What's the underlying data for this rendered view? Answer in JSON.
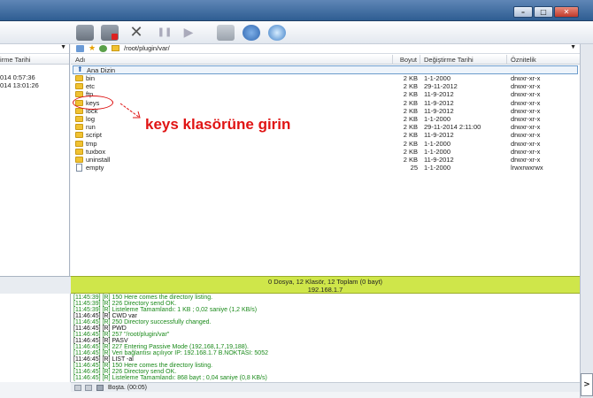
{
  "toolbar": {
    "icons": [
      "connect-icon",
      "disconnect-icon",
      "cancel-icon",
      "pause-icon",
      "play-icon",
      "queue-icon",
      "refresh-icon",
      "globe-icon"
    ],
    "path": "/root/plugin/var/"
  },
  "left_pane": {
    "header": "irme Tarihi",
    "dates": [
      "014 0:57:36",
      "014 13:01:26"
    ]
  },
  "file_list": {
    "columns": {
      "name": "Adı",
      "size": "Boyut",
      "date": "Değiştirme Tarihi",
      "perm": "Öznitelik"
    },
    "parent": "Ana Dizin",
    "rows": [
      {
        "name": "bin",
        "size": "2 KB",
        "date": "1-1-2000",
        "perm": "drwxr-xr-x",
        "type": "folder"
      },
      {
        "name": "etc",
        "size": "2 KB",
        "date": "29-11-2012",
        "perm": "drwxr-xr-x",
        "type": "folder"
      },
      {
        "name": "ftp",
        "size": "2 KB",
        "date": "11-9-2012",
        "perm": "drwxr-xr-x",
        "type": "folder"
      },
      {
        "name": "keys",
        "size": "2 KB",
        "date": "11-9-2012",
        "perm": "drwxr-xr-x",
        "type": "folder"
      },
      {
        "name": "lock",
        "size": "2 KB",
        "date": "11-9-2012",
        "perm": "drwxr-xr-x",
        "type": "folder"
      },
      {
        "name": "log",
        "size": "2 KB",
        "date": "1-1-2000",
        "perm": "drwxr-xr-x",
        "type": "folder"
      },
      {
        "name": "run",
        "size": "2 KB",
        "date": "29-11-2014 2:11:00",
        "perm": "drwxr-xr-x",
        "type": "folder"
      },
      {
        "name": "script",
        "size": "2 KB",
        "date": "11-9-2012",
        "perm": "drwxr-xr-x",
        "type": "folder"
      },
      {
        "name": "tmp",
        "size": "2 KB",
        "date": "1-1-2000",
        "perm": "drwxr-xr-x",
        "type": "folder"
      },
      {
        "name": "tuxbox",
        "size": "2 KB",
        "date": "1-1-2000",
        "perm": "drwxr-xr-x",
        "type": "folder"
      },
      {
        "name": "uninstall",
        "size": "2 KB",
        "date": "11-9-2012",
        "perm": "drwxr-xr-x",
        "type": "folder"
      },
      {
        "name": "empty",
        "size": "25",
        "date": "1-1-2000",
        "perm": "lrwxrwxrwx",
        "type": "file"
      }
    ]
  },
  "annotation": {
    "text": "keys klasörüne girin",
    "color": "#e01414"
  },
  "status": {
    "summary": "0 Dosya, 12 Klasör, 12 Toplam (0 bayt)",
    "host": "192.168.1.7"
  },
  "log": [
    {
      "text": "[11:45:39] [R] 150 Here comes the directory listing.",
      "color": "#1a8a1a"
    },
    {
      "text": "[11:45:39] [R] 226 Directory send OK.",
      "color": "#1a8a1a"
    },
    {
      "text": "[11:45:39] [R] Listeleme Tamamlandı: 1 KB ; 0,02 saniye (1,2 KB/s)",
      "color": "#1a8a1a"
    },
    {
      "text": "[11:46:45] [R] CWD var",
      "color": "#111111"
    },
    {
      "text": "[11:46:45] [R] 250 Directory successfully changed.",
      "color": "#1a8a1a"
    },
    {
      "text": "[11:46:45] [R] PWD",
      "color": "#111111"
    },
    {
      "text": "[11:46:45] [R] 257 \"/root/plugin/var\"",
      "color": "#1a8a1a"
    },
    {
      "text": "[11:46:45] [R] PASV",
      "color": "#111111"
    },
    {
      "text": "[11:46:45] [R] 227 Entering Passive Mode (192,168,1,7,19,188).",
      "color": "#1a8a1a"
    },
    {
      "text": "[11:46:45] [R] Veri bağlantısı açılıyor IP: 192.168.1.7 B.NOKTASI: 5052",
      "color": "#1a8a1a"
    },
    {
      "text": "[11:46:45] [R] LIST -al",
      "color": "#111111"
    },
    {
      "text": "[11:46:45] [R] 150 Here comes the directory listing.",
      "color": "#1a8a1a"
    },
    {
      "text": "[11:46:45] [R] 226 Directory send OK.",
      "color": "#1a8a1a"
    },
    {
      "text": "[11:46:45] [R] Listeleme Tamamlandı: 868 bayt ; 0,04 saniye (0,8 KB/s)",
      "color": "#1a8a1a"
    }
  ],
  "bottom": {
    "state": "Boşta. (00:05)"
  }
}
